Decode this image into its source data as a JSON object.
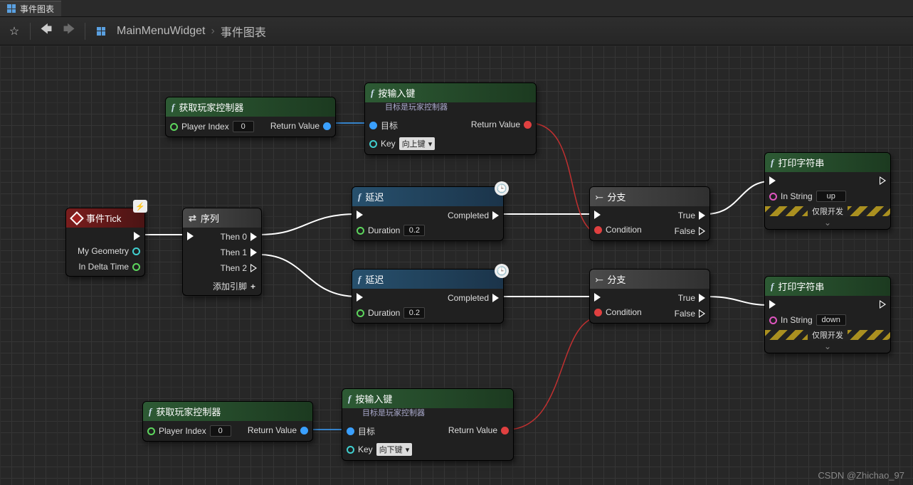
{
  "tab": {
    "title": "事件图表"
  },
  "breadcrumb": {
    "widget": "MainMenuWidget",
    "graph": "事件图表"
  },
  "watermark": "CSDN @Zhichao_97",
  "nodes": {
    "event_tick": {
      "title": "事件Tick",
      "out_geometry": "My Geometry",
      "out_delta": "In Delta Time"
    },
    "sequence": {
      "title": "序列",
      "then0": "Then 0",
      "then1": "Then 1",
      "then2": "Then 2",
      "add_pin": "添加引脚"
    },
    "get_pc1": {
      "title": "获取玩家控制器",
      "player_index": "Player Index",
      "player_index_val": "0",
      "return": "Return Value"
    },
    "get_pc2": {
      "title": "获取玩家控制器",
      "player_index": "Player Index",
      "player_index_val": "0",
      "return": "Return Value"
    },
    "input_key1": {
      "title": "按输入键",
      "sub": "目标是玩家控制器",
      "target": "目标",
      "key": "Key",
      "key_val": "向上键",
      "return": "Return Value"
    },
    "input_key2": {
      "title": "按输入键",
      "sub": "目标是玩家控制器",
      "target": "目标",
      "key": "Key",
      "key_val": "向下键",
      "return": "Return Value"
    },
    "delay1": {
      "title": "延迟",
      "duration": "Duration",
      "duration_val": "0.2",
      "completed": "Completed"
    },
    "delay2": {
      "title": "延迟",
      "duration": "Duration",
      "duration_val": "0.2",
      "completed": "Completed"
    },
    "branch1": {
      "title": "分支",
      "condition": "Condition",
      "true": "True",
      "false": "False"
    },
    "branch2": {
      "title": "分支",
      "condition": "Condition",
      "true": "True",
      "false": "False"
    },
    "print1": {
      "title": "打印字符串",
      "instring": "In String",
      "instring_val": "up",
      "dev": "仅限开发"
    },
    "print2": {
      "title": "打印字符串",
      "instring": "In String",
      "instring_val": "down",
      "dev": "仅限开发"
    }
  }
}
